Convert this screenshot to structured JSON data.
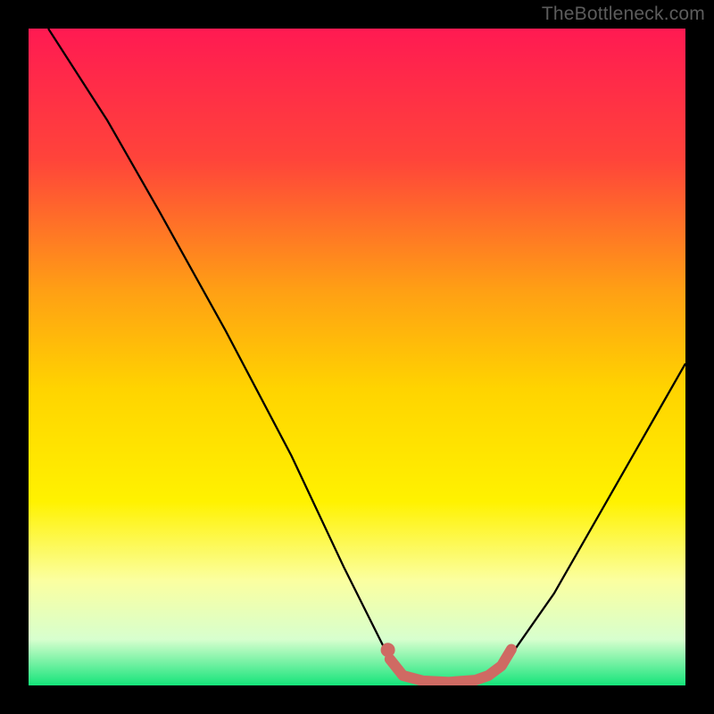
{
  "watermark": {
    "text": "TheBottleneck.com"
  },
  "chart_data": {
    "type": "line",
    "title": "",
    "xlabel": "",
    "ylabel": "",
    "xlim": [
      0,
      100
    ],
    "ylim": [
      0,
      100
    ],
    "grid": false,
    "legend": false,
    "gradient": {
      "stops": [
        {
          "offset": 0,
          "color": "#ff1a52"
        },
        {
          "offset": 20,
          "color": "#ff443a"
        },
        {
          "offset": 40,
          "color": "#ffa014"
        },
        {
          "offset": 55,
          "color": "#ffd400"
        },
        {
          "offset": 72,
          "color": "#fff200"
        },
        {
          "offset": 84,
          "color": "#fbffa0"
        },
        {
          "offset": 93,
          "color": "#d7ffce"
        },
        {
          "offset": 100,
          "color": "#15e47a"
        }
      ]
    },
    "series": [
      {
        "name": "bottleneck-curve",
        "color": "#000000",
        "width": 2.3,
        "points": [
          {
            "x": 3,
            "y": 100
          },
          {
            "x": 12,
            "y": 86
          },
          {
            "x": 20,
            "y": 72
          },
          {
            "x": 30,
            "y": 54
          },
          {
            "x": 40,
            "y": 35
          },
          {
            "x": 48,
            "y": 18
          },
          {
            "x": 54,
            "y": 6
          },
          {
            "x": 57,
            "y": 1.5
          },
          {
            "x": 60,
            "y": 0.5
          },
          {
            "x": 66,
            "y": 0.5
          },
          {
            "x": 70,
            "y": 1.5
          },
          {
            "x": 73,
            "y": 4
          },
          {
            "x": 80,
            "y": 14
          },
          {
            "x": 88,
            "y": 28
          },
          {
            "x": 96,
            "y": 42
          },
          {
            "x": 100,
            "y": 49
          }
        ]
      },
      {
        "name": "sweet-spot-highlight",
        "color": "#cf6a63",
        "width": 12,
        "linecap": "round",
        "points": [
          {
            "x": 55,
            "y": 4
          },
          {
            "x": 57,
            "y": 1.5
          },
          {
            "x": 60,
            "y": 0.7
          },
          {
            "x": 64,
            "y": 0.5
          },
          {
            "x": 68,
            "y": 0.8
          },
          {
            "x": 70,
            "y": 1.5
          },
          {
            "x": 72,
            "y": 3
          },
          {
            "x": 73.5,
            "y": 5.5
          }
        ]
      },
      {
        "name": "sweet-spot-start-dot",
        "color": "#cf6a63",
        "type": "point",
        "radius": 8,
        "point": {
          "x": 54.7,
          "y": 5.4
        }
      }
    ]
  }
}
